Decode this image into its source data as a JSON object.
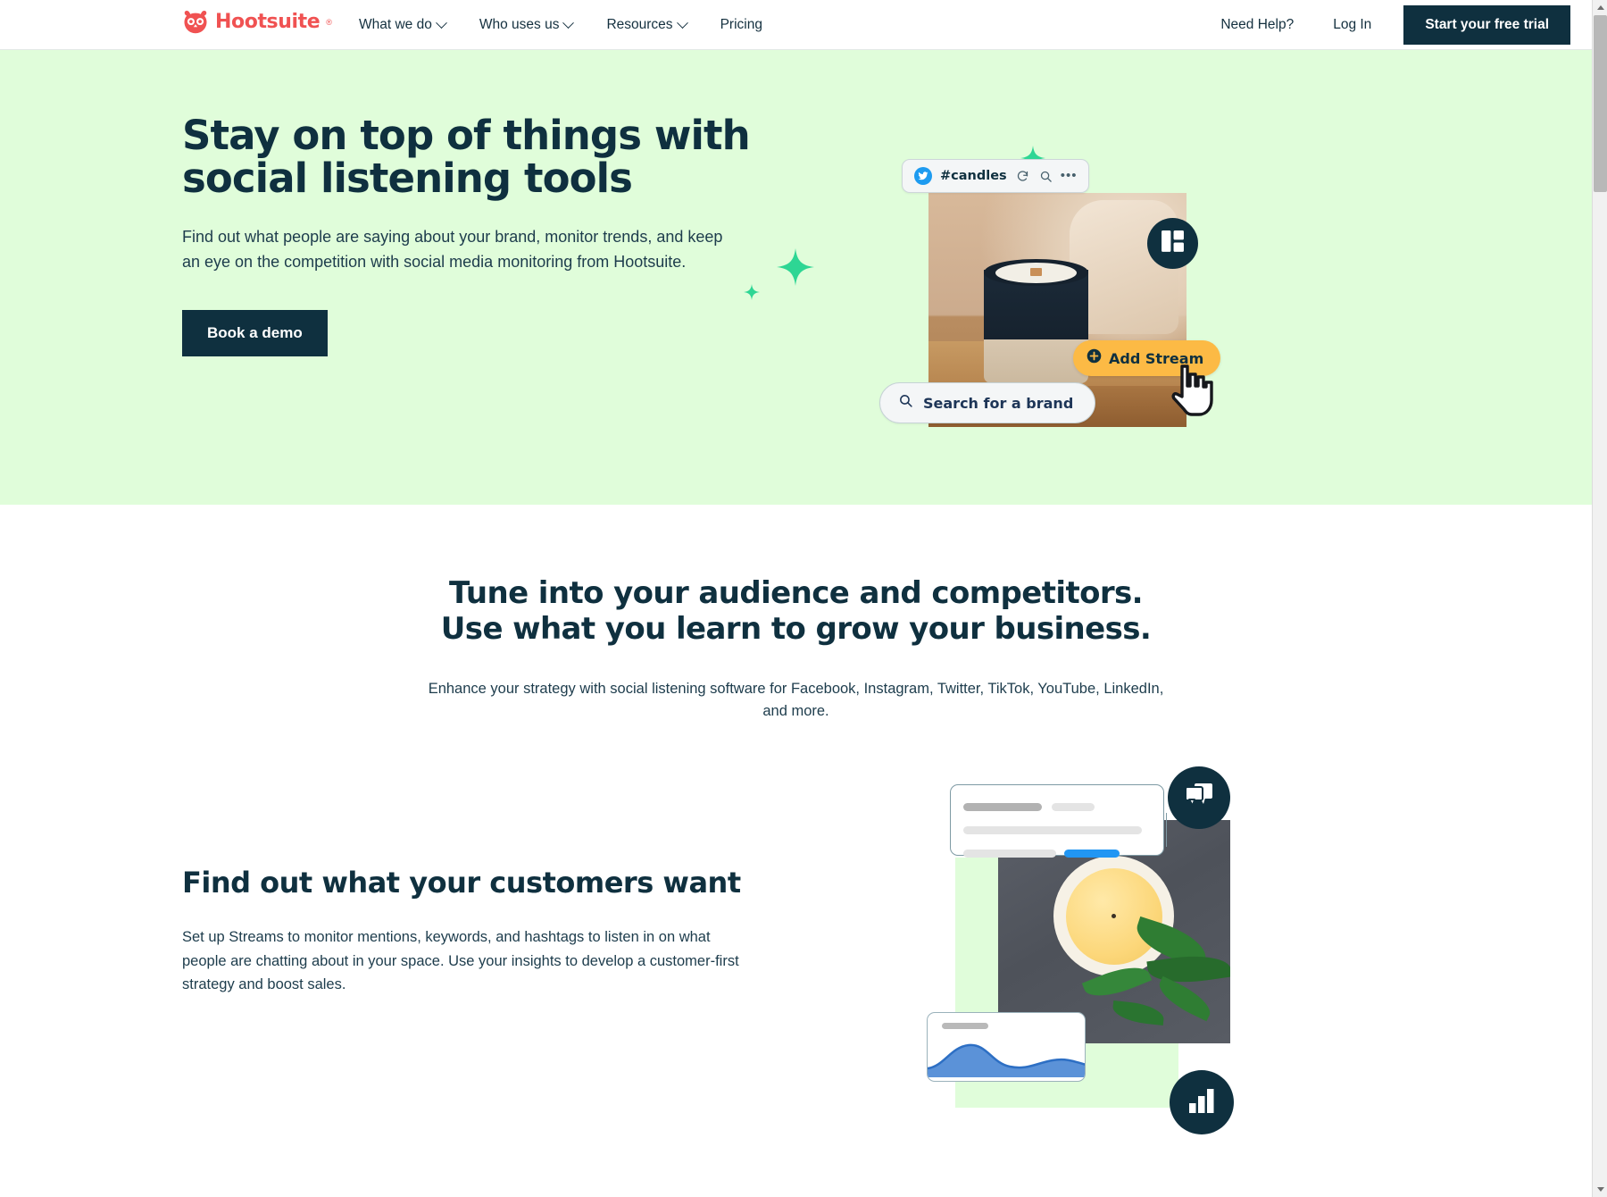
{
  "brand": {
    "name": "Hootsuite",
    "trademark": "®",
    "logo_icon": "owl-logo",
    "color": "#f05252"
  },
  "colors": {
    "hero_background": "#e0fdda",
    "dark_navy": "#0f303f",
    "accent_yellow": "#fcba45",
    "twitter_blue": "#1d9bf0",
    "sparkle_green": "#2ed694"
  },
  "header": {
    "nav_items": [
      {
        "label": "What we do",
        "has_dropdown": true
      },
      {
        "label": "Who uses us",
        "has_dropdown": true
      },
      {
        "label": "Resources",
        "has_dropdown": true
      },
      {
        "label": "Pricing",
        "has_dropdown": false
      }
    ],
    "help_link": "Need Help?",
    "login_link": "Log In",
    "cta_label": "Start your free trial"
  },
  "hero": {
    "title": "Stay on top of things with social listening tools",
    "subtitle": "Find out what people are saying about your brand, monitor trends, and keep an eye on the competition with social media monitoring from Hootsuite.",
    "cta_label": "Book a demo",
    "art": {
      "stream_chip": {
        "network_icon": "twitter-icon",
        "label": "#candles",
        "actions": [
          "refresh-icon",
          "search-icon",
          "more-options-icon"
        ]
      },
      "dashboard_badge_icon": "dashboard-grid-icon",
      "add_stream_label": "Add Stream",
      "add_stream_icon": "plus-circle-icon",
      "search_pill_label": "Search for a brand",
      "search_pill_icon": "search-icon",
      "cursor_icon": "pointer-hand-cursor"
    }
  },
  "mid_section": {
    "title_line1": "Tune into your audience and competitors.",
    "title_line2": "Use what you learn to grow your business.",
    "subtitle": "Enhance your strategy with social listening software for Facebook, Instagram, Twitter, TikTok, YouTube, LinkedIn, and more."
  },
  "feature": {
    "title": "Find out what your customers want",
    "body": "Set up Streams to monitor mentions, keywords, and hashtags to listen in on what people are chatting about in your space. Use your insights to develop a customer-first strategy and boost sales.",
    "art": {
      "chat_badge_icon": "chat-bubbles-icon",
      "chart_badge_icon": "bar-chart-icon",
      "post_card_icon": "post-placeholder-card",
      "analytics_card_icon": "area-chart-card"
    }
  },
  "scrollbar": {
    "up_icon": "scroll-up-arrow",
    "down_icon": "scroll-down-arrow",
    "thumb": "scroll-thumb"
  }
}
